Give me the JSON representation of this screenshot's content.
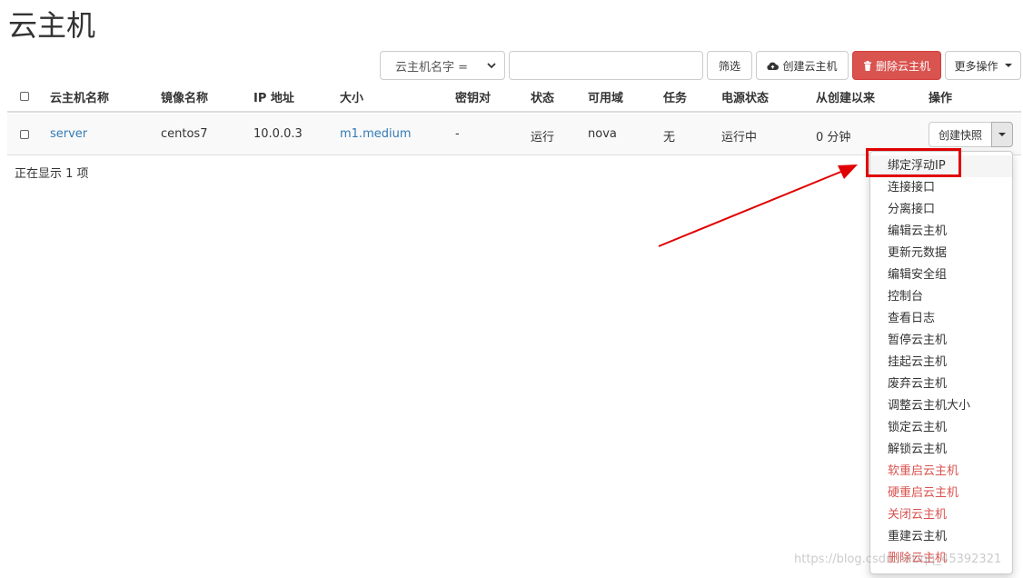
{
  "page": {
    "title": "云主机"
  },
  "toolbar": {
    "filter_select_value": "云主机名字 =",
    "filter_input_value": "",
    "filter_button": "筛选",
    "create_button": "创建云主机",
    "delete_button": "删除云主机",
    "more_button": "更多操作"
  },
  "table": {
    "headers": [
      "云主机名称",
      "镜像名称",
      "IP 地址",
      "大小",
      "密钥对",
      "状态",
      "可用域",
      "任务",
      "电源状态",
      "从创建以来",
      "操作"
    ],
    "rows": [
      {
        "name": "server",
        "image": "centos7",
        "ip": "10.0.0.3",
        "size": "m1.medium",
        "keypair": "-",
        "status": "运行",
        "zone": "nova",
        "task": "无",
        "power": "运行中",
        "age": "0 分钟",
        "action_button": "创建快照"
      }
    ],
    "footer": "正在显示 1 项"
  },
  "dropdown": {
    "items": [
      {
        "label": "绑定浮动IP",
        "danger": false
      },
      {
        "label": "连接接口",
        "danger": false
      },
      {
        "label": "分离接口",
        "danger": false
      },
      {
        "label": "编辑云主机",
        "danger": false
      },
      {
        "label": "更新元数据",
        "danger": false
      },
      {
        "label": "编辑安全组",
        "danger": false
      },
      {
        "label": "控制台",
        "danger": false
      },
      {
        "label": "查看日志",
        "danger": false
      },
      {
        "label": "暂停云主机",
        "danger": false
      },
      {
        "label": "挂起云主机",
        "danger": false
      },
      {
        "label": "废弃云主机",
        "danger": false
      },
      {
        "label": "调整云主机大小",
        "danger": false
      },
      {
        "label": "锁定云主机",
        "danger": false
      },
      {
        "label": "解锁云主机",
        "danger": false
      },
      {
        "label": "软重启云主机",
        "danger": true
      },
      {
        "label": "硬重启云主机",
        "danger": true
      },
      {
        "label": "关闭云主机",
        "danger": true
      },
      {
        "label": "重建云主机",
        "danger": false
      },
      {
        "label": "删除云主机",
        "danger": true
      }
    ]
  },
  "colors": {
    "link": "#337ab7",
    "danger": "#d9534f",
    "annotation": "#e00000"
  },
  "watermark": "https://blog.csdn.net/qq_45392321"
}
